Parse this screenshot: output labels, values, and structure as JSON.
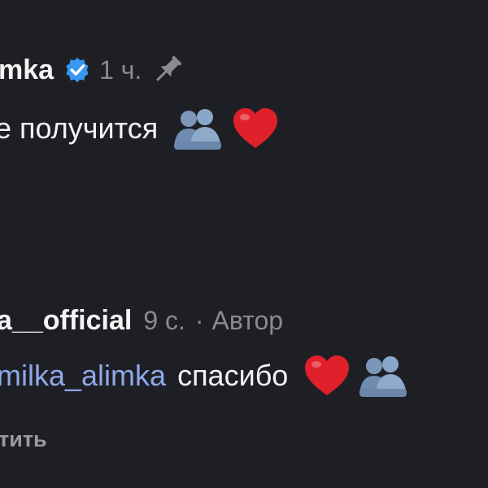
{
  "first_comment": {
    "username": "mka",
    "time": "1 ч.",
    "text": "е получится",
    "icons": [
      "verified-badge-icon",
      "pin-icon",
      "people-emoji-icon",
      "red-heart-emoji-icon"
    ],
    "colors": {
      "verified": "#3897f0",
      "heart": "#e0202a"
    }
  },
  "second_comment": {
    "username": "a__official",
    "time": "9 с.",
    "separator": "·",
    "author_label": "Автор",
    "mention": "milka_alimka",
    "text": "спасибо",
    "reply_label": "тить",
    "icons": [
      "red-heart-emoji-icon",
      "people-emoji-icon"
    ],
    "colors": {
      "mention": "#8fa8e8"
    }
  }
}
